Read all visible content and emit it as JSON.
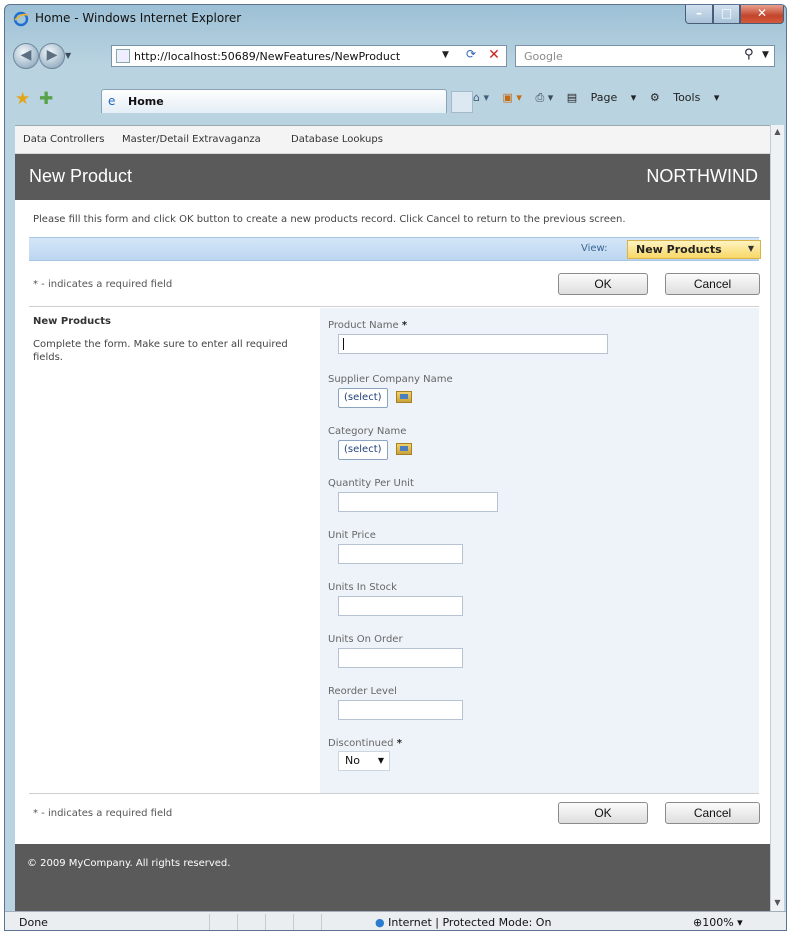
{
  "window": {
    "title": "Home - Windows Internet Explorer"
  },
  "addressbar": {
    "url": "http://localhost:50689/NewFeatures/NewProduct"
  },
  "searchbox": {
    "placeholder": "Google"
  },
  "commandbar": {
    "tab_label": "Home",
    "page_label": "Page",
    "tools_label": "Tools"
  },
  "topmenu": {
    "items": [
      {
        "label": "Data Controllers"
      },
      {
        "label": "Master/Detail Extravaganza"
      },
      {
        "label": "Database Lookups"
      }
    ]
  },
  "header": {
    "page_title": "New Product",
    "brand": "NORTHWIND"
  },
  "instructions": "Please fill this form and click OK button to create a new products record. Click Cancel to return to the previous screen.",
  "viewbar": {
    "label": "View:",
    "selected": "New Products"
  },
  "required_note": "* - indicates a required field",
  "buttons": {
    "ok": "OK",
    "cancel": "Cancel"
  },
  "form": {
    "section_title": "New Products",
    "section_text": "Complete the form. Make sure to enter all required fields.",
    "required_mark": "*",
    "fields": [
      {
        "label": "Product Name",
        "required": true,
        "type": "text",
        "value": ""
      },
      {
        "label": "Supplier Company Name",
        "type": "lookup",
        "value": "(select)"
      },
      {
        "label": "Category Name",
        "type": "lookup",
        "value": "(select)"
      },
      {
        "label": "Quantity Per Unit",
        "type": "text",
        "value": ""
      },
      {
        "label": "Unit Price",
        "type": "text",
        "value": ""
      },
      {
        "label": "Units In Stock",
        "type": "text",
        "value": ""
      },
      {
        "label": "Units On Order",
        "type": "text",
        "value": ""
      },
      {
        "label": "Reorder Level",
        "type": "text",
        "value": ""
      },
      {
        "label": "Discontinued",
        "required": true,
        "type": "select",
        "value": "No"
      }
    ]
  },
  "footer": {
    "copyright": "© 2009 MyCompany. All rights reserved."
  },
  "statusbar": {
    "status": "Done",
    "zone": "Internet | Protected Mode: On",
    "zoom": "100%"
  },
  "colors": {
    "header_bg": "#5a5a5a",
    "viewbar_bg": "#c8def4",
    "view_select_bg": "#f8d766",
    "form_panel_bg": "#eef3f9"
  }
}
